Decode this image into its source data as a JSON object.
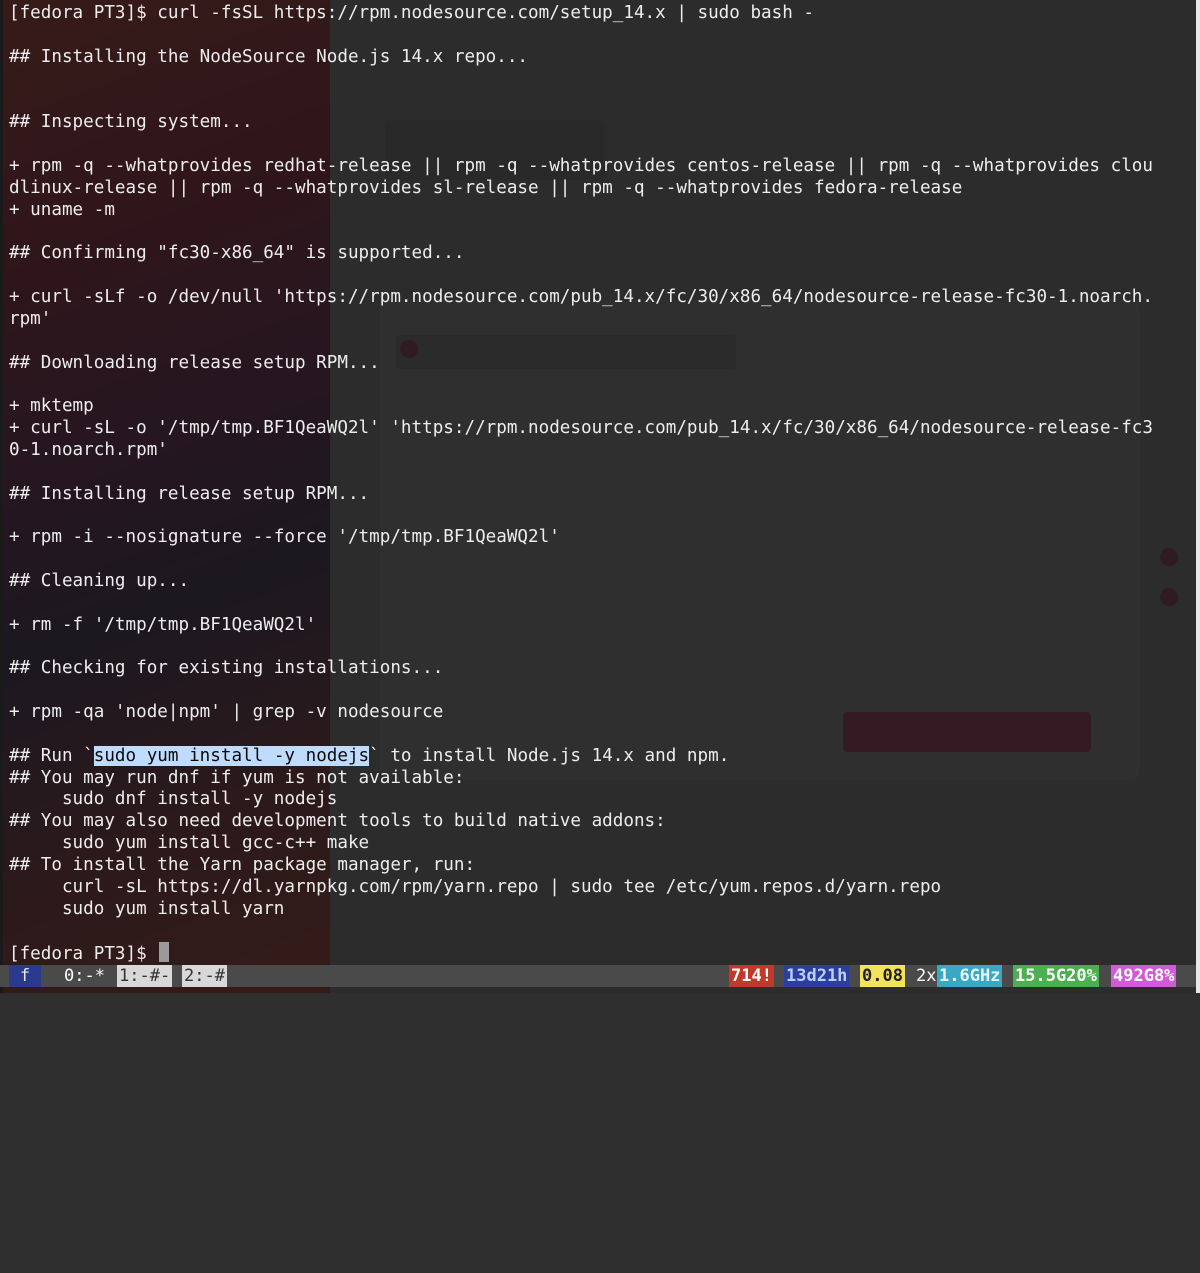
{
  "terminal": {
    "lines": [
      "[fedora PT3]$ curl -fsSL https://rpm.nodesource.com/setup_14.x | sudo bash -",
      "",
      "## Installing the NodeSource Node.js 14.x repo...",
      "",
      "",
      "## Inspecting system...",
      "",
      "+ rpm -q --whatprovides redhat-release || rpm -q --whatprovides centos-release || rpm -q --whatprovides clou",
      "dlinux-release || rpm -q --whatprovides sl-release || rpm -q --whatprovides fedora-release",
      "+ uname -m",
      "",
      "## Confirming \"fc30-x86_64\" is supported...",
      "",
      "+ curl -sLf -o /dev/null 'https://rpm.nodesource.com/pub_14.x/fc/30/x86_64/nodesource-release-fc30-1.noarch.",
      "rpm'",
      "",
      "## Downloading release setup RPM...",
      "",
      "+ mktemp",
      "+ curl -sL -o '/tmp/tmp.BF1QeaWQ2l' 'https://rpm.nodesource.com/pub_14.x/fc/30/x86_64/nodesource-release-fc3",
      "0-1.noarch.rpm'",
      "",
      "## Installing release setup RPM...",
      "",
      "+ rpm -i --nosignature --force '/tmp/tmp.BF1QeaWQ2l'",
      "",
      "## Cleaning up...",
      "",
      "+ rm -f '/tmp/tmp.BF1QeaWQ2l'",
      "",
      "## Checking for existing installations...",
      "",
      "+ rpm -qa 'node|npm' | grep -v nodesource",
      ""
    ],
    "run_line": {
      "prefix": "## Run `",
      "highlight": "sudo yum install -y nodejs",
      "suffix": "` to install Node.js 14.x and npm."
    },
    "tail_lines": [
      "## You may run dnf if yum is not available:",
      "     sudo dnf install -y nodejs",
      "## You may also need development tools to build native addons:",
      "     sudo yum install gcc-c++ make",
      "## To install the Yarn package manager, run:",
      "     curl -sL https://dl.yarnpkg.com/rpm/yarn.repo | sudo tee /etc/yum.repos.d/yarn.repo",
      "     sudo yum install yarn",
      ""
    ],
    "prompt": "[fedora PT3]$ "
  },
  "statusbar": {
    "session": "f",
    "windows": [
      "0:-*",
      "1:-#-",
      "2:-#"
    ],
    "right": [
      {
        "text": "714!",
        "bg": "#c0392b",
        "fg": "#ffffff"
      },
      {
        "text": "13d21h",
        "bg": "#2c3e9e",
        "fg": "#bcd0ff"
      },
      {
        "text": "0.08",
        "bg": "#f1e35a",
        "fg": "#222222"
      },
      {
        "text": "2x",
        "bg": "#4a4a4a",
        "fg": "#ffffff"
      },
      {
        "text": "1.6GHz",
        "bg": "#3ba7c4",
        "fg": "#e8f8ff"
      },
      {
        "text": "15.5G20%",
        "bg": "#4caf50",
        "fg": "#ffffff"
      },
      {
        "text": "492G8%",
        "bg": "#d15ad9",
        "fg": "#ffffff"
      }
    ]
  }
}
